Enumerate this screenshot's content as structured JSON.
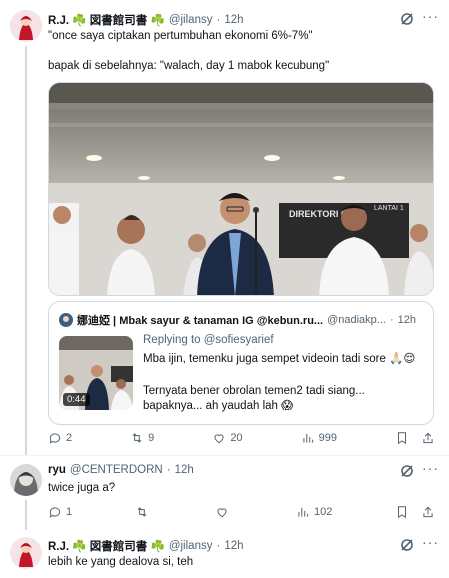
{
  "tweet1": {
    "name": "R.J. ☘️ 図書館司書 ☘️",
    "handle": "@jilansy",
    "time": "12h",
    "text_line1": "\"once saya ciptakan pertumbuhan ekonomi 6%-7%\"",
    "text_line2": "bapak di sebelahnya: \"walach, day 1 mabok kecubung\"",
    "quote": {
      "name": "娜迪婭 | Mbak sayur & tanaman IG @kebun.ru...",
      "handle": "@nadiakp...",
      "time": "12h",
      "replying": "Replying to @sofiesyarief",
      "line1": "Mba ijin, temenku juga sempet videoin tadi sore 🙏🏻😌",
      "line2": "Ternyata bener obrolan temen2 tadi siang...",
      "line3": "bapaknya... ah yaudah lah 😱",
      "duration": "0:44"
    },
    "media_sign": "DIREKTORI G",
    "media_sign2": "LANTAI 1",
    "actions": {
      "replies": "2",
      "reposts": "9",
      "likes": "20",
      "views": "999"
    }
  },
  "tweet2": {
    "name": "ryu",
    "handle": "@CENTERDORN",
    "time": "12h",
    "text": "twice juga a?",
    "actions": {
      "replies": "1",
      "reposts": "",
      "likes": "",
      "views": "102"
    }
  },
  "tweet3": {
    "name": "R.J. ☘️ 図書館司書 ☘️",
    "handle": "@jilansy",
    "time": "12h",
    "text": "lebih ke yang dealova si, teh"
  },
  "colors": {
    "text": "#0f1419",
    "secondary": "#536471",
    "border": "#cfd9de",
    "clover": "#2e9d3a"
  },
  "icons": [
    "grok-icon",
    "more-icon",
    "reply-icon",
    "repost-icon",
    "like-icon",
    "views-icon",
    "bookmark-icon",
    "share-icon"
  ]
}
